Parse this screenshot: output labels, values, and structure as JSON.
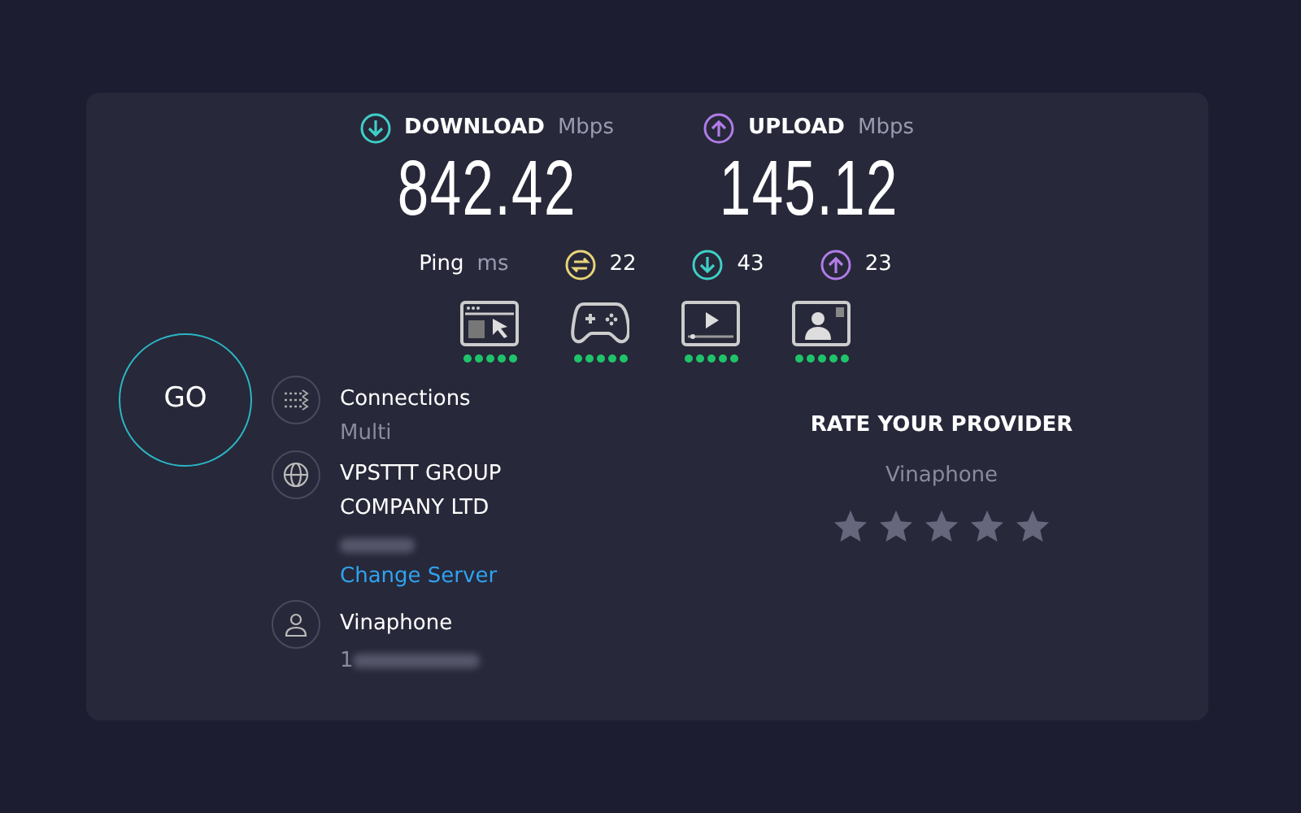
{
  "speeds": [
    {
      "kind": "download",
      "label": "DOWNLOAD",
      "unit": "Mbps",
      "value": "842.42"
    },
    {
      "kind": "upload",
      "label": "UPLOAD",
      "unit": "Mbps",
      "value": "145.12"
    }
  ],
  "ping": {
    "label": "Ping",
    "unit": "ms",
    "readings": [
      {
        "kind": "jitter",
        "value": "22"
      },
      {
        "kind": "download",
        "value": "43"
      },
      {
        "kind": "upload",
        "value": "23"
      }
    ]
  },
  "quality": [
    {
      "kind": "browsing",
      "stars": 5
    },
    {
      "kind": "gaming",
      "stars": 5
    },
    {
      "kind": "video",
      "stars": 5
    },
    {
      "kind": "calls",
      "stars": 5
    }
  ],
  "go_button": "GO",
  "connections": {
    "label": "Connections",
    "value": "Multi"
  },
  "server": {
    "name": "VPSTTT GROUP COMPANY LTD",
    "link": "Change Server"
  },
  "provider": {
    "name": "Vinaphone",
    "ip_visible": "1"
  },
  "rating": {
    "title": "RATE YOUR PROVIDER",
    "provider": "Vinaphone",
    "stars": 0
  }
}
